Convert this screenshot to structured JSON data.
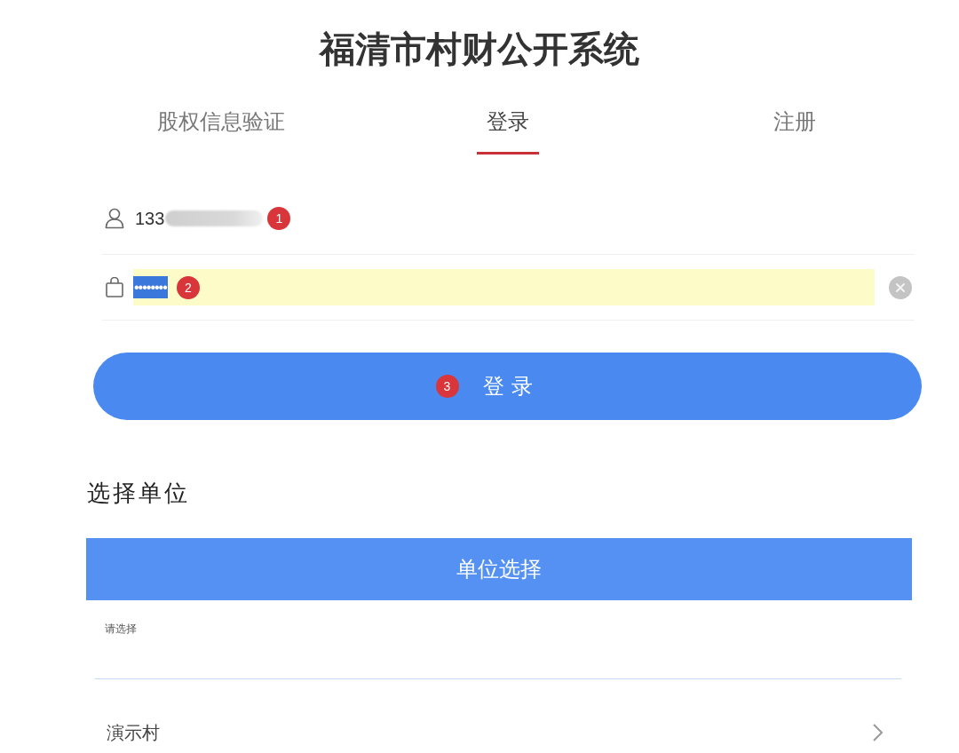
{
  "title": "福清市村财公开系统",
  "tabs": [
    {
      "label": "股权信息验证",
      "selected": false
    },
    {
      "label": "登录",
      "selected": true
    },
    {
      "label": "注册",
      "selected": false
    }
  ],
  "login_form": {
    "username": {
      "value": "133",
      "redacted": true,
      "annotation": "1"
    },
    "password": {
      "value": "••••••••",
      "autofilled": true,
      "text_selected": true,
      "clearable": true,
      "annotation": "2"
    },
    "submit": {
      "label": "登录",
      "annotation": "3"
    }
  },
  "unit_section": {
    "heading": "选择单位",
    "picker": {
      "title": "单位选择",
      "hint": "请选择"
    },
    "options": [
      {
        "label": "演示村"
      }
    ]
  }
}
